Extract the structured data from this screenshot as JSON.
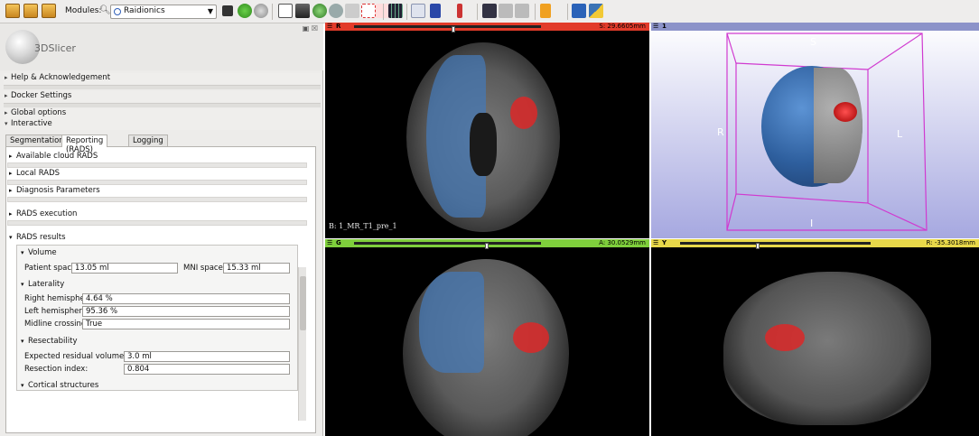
{
  "toolbar": {
    "modules_label": "Modules:",
    "module_selected": "Raidionics",
    "icons": [
      "load-data-icon",
      "load-dicom-icon",
      "save-icon",
      "python-console-icon",
      "back-icon",
      "forward-icon",
      "models-icon",
      "volumes-icon",
      "markups-icon",
      "transforms-icon",
      "segment-editor-icon",
      "layout-icon",
      "pointer-icon",
      "crosshair-icon",
      "pan-icon",
      "screenshot-icon",
      "extension-icon",
      "python-icon"
    ]
  },
  "left_panel": {
    "logo_text": "3DSlicer",
    "sections": [
      {
        "label": "Help & Acknowledgement"
      },
      {
        "label": "Docker Settings"
      },
      {
        "label": "Global options"
      },
      {
        "label": "Interactive"
      }
    ],
    "tabs": [
      {
        "label": "Segmentation",
        "active": false
      },
      {
        "label": "Reporting (RADS)",
        "active": true
      },
      {
        "label": "Logging",
        "active": false
      }
    ],
    "subsections": [
      {
        "label": "Available cloud RADS"
      },
      {
        "label": "Local RADS"
      },
      {
        "label": "Diagnosis Parameters"
      },
      {
        "label": "RADS execution"
      },
      {
        "label": "RADS results"
      }
    ],
    "results": {
      "volume": {
        "title": "Volume",
        "patient_space_label": "Patient space:",
        "patient_space_value": "13.05 ml",
        "mni_space_label": "MNI space:",
        "mni_space_value": "15.33 ml"
      },
      "laterality": {
        "title": "Laterality",
        "right_label": "Right hemisphere:",
        "right_value": "4.64 %",
        "left_label": "Left hemisphere:",
        "left_value": "95.36 %",
        "midline_label": "Midline crossing:",
        "midline_value": "True"
      },
      "resectability": {
        "title": "Resectability",
        "residual_label": "Expected residual volume (ml):",
        "residual_value": "3.0 ml",
        "index_label": "Resection index:",
        "index_value": "0.804"
      },
      "cortical": {
        "title": "Cortical structures"
      }
    }
  },
  "views": {
    "red": {
      "name": "R",
      "offset": "S: 29.6605mm",
      "color": "#e23b2a",
      "volume_label": "B: 1_MR_T1_pre_1"
    },
    "threed": {
      "name": "1",
      "color": "#8c93c9",
      "orient": {
        "top": "S",
        "bottom": "I",
        "left": "R",
        "right": "L"
      }
    },
    "green": {
      "name": "G",
      "offset": "A: 30.0529mm",
      "color": "#7fcf3c"
    },
    "yellow": {
      "name": "Y",
      "offset": "R: -35.3018mm",
      "color": "#e8d84a"
    }
  }
}
